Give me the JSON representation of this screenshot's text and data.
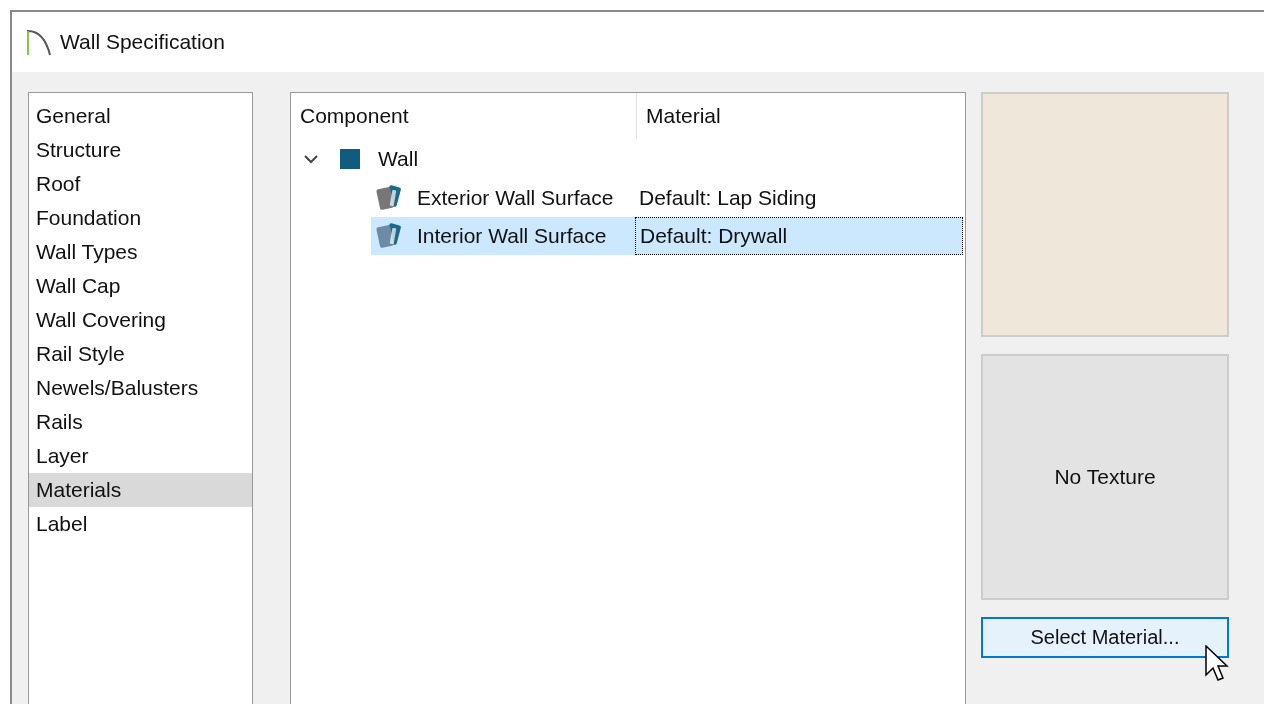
{
  "window": {
    "title": "Wall Specification"
  },
  "categories": [
    {
      "label": "General",
      "selected": false
    },
    {
      "label": "Structure",
      "selected": false
    },
    {
      "label": "Roof",
      "selected": false
    },
    {
      "label": "Foundation",
      "selected": false
    },
    {
      "label": "Wall Types",
      "selected": false
    },
    {
      "label": "Wall Cap",
      "selected": false
    },
    {
      "label": "Wall Covering",
      "selected": false
    },
    {
      "label": "Rail Style",
      "selected": false
    },
    {
      "label": "Newels/Balusters",
      "selected": false
    },
    {
      "label": "Rails",
      "selected": false
    },
    {
      "label": "Layer",
      "selected": false
    },
    {
      "label": "Materials",
      "selected": true
    },
    {
      "label": "Label",
      "selected": false
    }
  ],
  "tree": {
    "columns": [
      "Component",
      "Material"
    ],
    "rows": [
      {
        "component": "Wall",
        "expanded": true,
        "selected": false,
        "children": [
          {
            "component": "Exterior Wall Surface",
            "material": "Default: Lap Siding",
            "selected": false
          },
          {
            "component": "Interior Wall Surface",
            "material": "Default: Drywall",
            "selected": true
          }
        ]
      }
    ]
  },
  "texture_preview": {
    "text": "No Texture"
  },
  "select_button": {
    "label": "Select Material..."
  }
}
